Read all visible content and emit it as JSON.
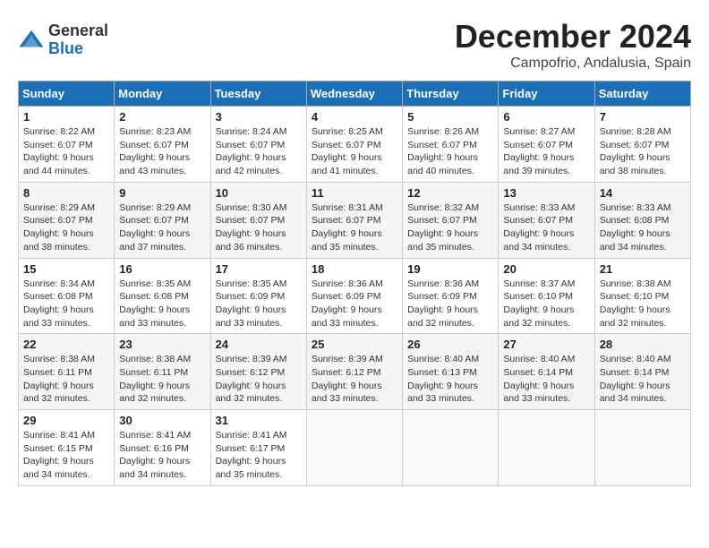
{
  "header": {
    "logo_general": "General",
    "logo_blue": "Blue",
    "month": "December 2024",
    "location": "Campofrio, Andalusia, Spain"
  },
  "weekdays": [
    "Sunday",
    "Monday",
    "Tuesday",
    "Wednesday",
    "Thursday",
    "Friday",
    "Saturday"
  ],
  "weeks": [
    [
      {
        "day": "1",
        "rise": "Sunrise: 8:22 AM",
        "set": "Sunset: 6:07 PM",
        "daylight": "Daylight: 9 hours and 44 minutes."
      },
      {
        "day": "2",
        "rise": "Sunrise: 8:23 AM",
        "set": "Sunset: 6:07 PM",
        "daylight": "Daylight: 9 hours and 43 minutes."
      },
      {
        "day": "3",
        "rise": "Sunrise: 8:24 AM",
        "set": "Sunset: 6:07 PM",
        "daylight": "Daylight: 9 hours and 42 minutes."
      },
      {
        "day": "4",
        "rise": "Sunrise: 8:25 AM",
        "set": "Sunset: 6:07 PM",
        "daylight": "Daylight: 9 hours and 41 minutes."
      },
      {
        "day": "5",
        "rise": "Sunrise: 8:26 AM",
        "set": "Sunset: 6:07 PM",
        "daylight": "Daylight: 9 hours and 40 minutes."
      },
      {
        "day": "6",
        "rise": "Sunrise: 8:27 AM",
        "set": "Sunset: 6:07 PM",
        "daylight": "Daylight: 9 hours and 39 minutes."
      },
      {
        "day": "7",
        "rise": "Sunrise: 8:28 AM",
        "set": "Sunset: 6:07 PM",
        "daylight": "Daylight: 9 hours and 38 minutes."
      }
    ],
    [
      {
        "day": "8",
        "rise": "Sunrise: 8:29 AM",
        "set": "Sunset: 6:07 PM",
        "daylight": "Daylight: 9 hours and 38 minutes."
      },
      {
        "day": "9",
        "rise": "Sunrise: 8:29 AM",
        "set": "Sunset: 6:07 PM",
        "daylight": "Daylight: 9 hours and 37 minutes."
      },
      {
        "day": "10",
        "rise": "Sunrise: 8:30 AM",
        "set": "Sunset: 6:07 PM",
        "daylight": "Daylight: 9 hours and 36 minutes."
      },
      {
        "day": "11",
        "rise": "Sunrise: 8:31 AM",
        "set": "Sunset: 6:07 PM",
        "daylight": "Daylight: 9 hours and 35 minutes."
      },
      {
        "day": "12",
        "rise": "Sunrise: 8:32 AM",
        "set": "Sunset: 6:07 PM",
        "daylight": "Daylight: 9 hours and 35 minutes."
      },
      {
        "day": "13",
        "rise": "Sunrise: 8:33 AM",
        "set": "Sunset: 6:07 PM",
        "daylight": "Daylight: 9 hours and 34 minutes."
      },
      {
        "day": "14",
        "rise": "Sunrise: 8:33 AM",
        "set": "Sunset: 6:08 PM",
        "daylight": "Daylight: 9 hours and 34 minutes."
      }
    ],
    [
      {
        "day": "15",
        "rise": "Sunrise: 8:34 AM",
        "set": "Sunset: 6:08 PM",
        "daylight": "Daylight: 9 hours and 33 minutes."
      },
      {
        "day": "16",
        "rise": "Sunrise: 8:35 AM",
        "set": "Sunset: 6:08 PM",
        "daylight": "Daylight: 9 hours and 33 minutes."
      },
      {
        "day": "17",
        "rise": "Sunrise: 8:35 AM",
        "set": "Sunset: 6:09 PM",
        "daylight": "Daylight: 9 hours and 33 minutes."
      },
      {
        "day": "18",
        "rise": "Sunrise: 8:36 AM",
        "set": "Sunset: 6:09 PM",
        "daylight": "Daylight: 9 hours and 33 minutes."
      },
      {
        "day": "19",
        "rise": "Sunrise: 8:36 AM",
        "set": "Sunset: 6:09 PM",
        "daylight": "Daylight: 9 hours and 32 minutes."
      },
      {
        "day": "20",
        "rise": "Sunrise: 8:37 AM",
        "set": "Sunset: 6:10 PM",
        "daylight": "Daylight: 9 hours and 32 minutes."
      },
      {
        "day": "21",
        "rise": "Sunrise: 8:38 AM",
        "set": "Sunset: 6:10 PM",
        "daylight": "Daylight: 9 hours and 32 minutes."
      }
    ],
    [
      {
        "day": "22",
        "rise": "Sunrise: 8:38 AM",
        "set": "Sunset: 6:11 PM",
        "daylight": "Daylight: 9 hours and 32 minutes."
      },
      {
        "day": "23",
        "rise": "Sunrise: 8:38 AM",
        "set": "Sunset: 6:11 PM",
        "daylight": "Daylight: 9 hours and 32 minutes."
      },
      {
        "day": "24",
        "rise": "Sunrise: 8:39 AM",
        "set": "Sunset: 6:12 PM",
        "daylight": "Daylight: 9 hours and 32 minutes."
      },
      {
        "day": "25",
        "rise": "Sunrise: 8:39 AM",
        "set": "Sunset: 6:12 PM",
        "daylight": "Daylight: 9 hours and 33 minutes."
      },
      {
        "day": "26",
        "rise": "Sunrise: 8:40 AM",
        "set": "Sunset: 6:13 PM",
        "daylight": "Daylight: 9 hours and 33 minutes."
      },
      {
        "day": "27",
        "rise": "Sunrise: 8:40 AM",
        "set": "Sunset: 6:14 PM",
        "daylight": "Daylight: 9 hours and 33 minutes."
      },
      {
        "day": "28",
        "rise": "Sunrise: 8:40 AM",
        "set": "Sunset: 6:14 PM",
        "daylight": "Daylight: 9 hours and 34 minutes."
      }
    ],
    [
      {
        "day": "29",
        "rise": "Sunrise: 8:41 AM",
        "set": "Sunset: 6:15 PM",
        "daylight": "Daylight: 9 hours and 34 minutes."
      },
      {
        "day": "30",
        "rise": "Sunrise: 8:41 AM",
        "set": "Sunset: 6:16 PM",
        "daylight": "Daylight: 9 hours and 34 minutes."
      },
      {
        "day": "31",
        "rise": "Sunrise: 8:41 AM",
        "set": "Sunset: 6:17 PM",
        "daylight": "Daylight: 9 hours and 35 minutes."
      },
      null,
      null,
      null,
      null
    ]
  ]
}
